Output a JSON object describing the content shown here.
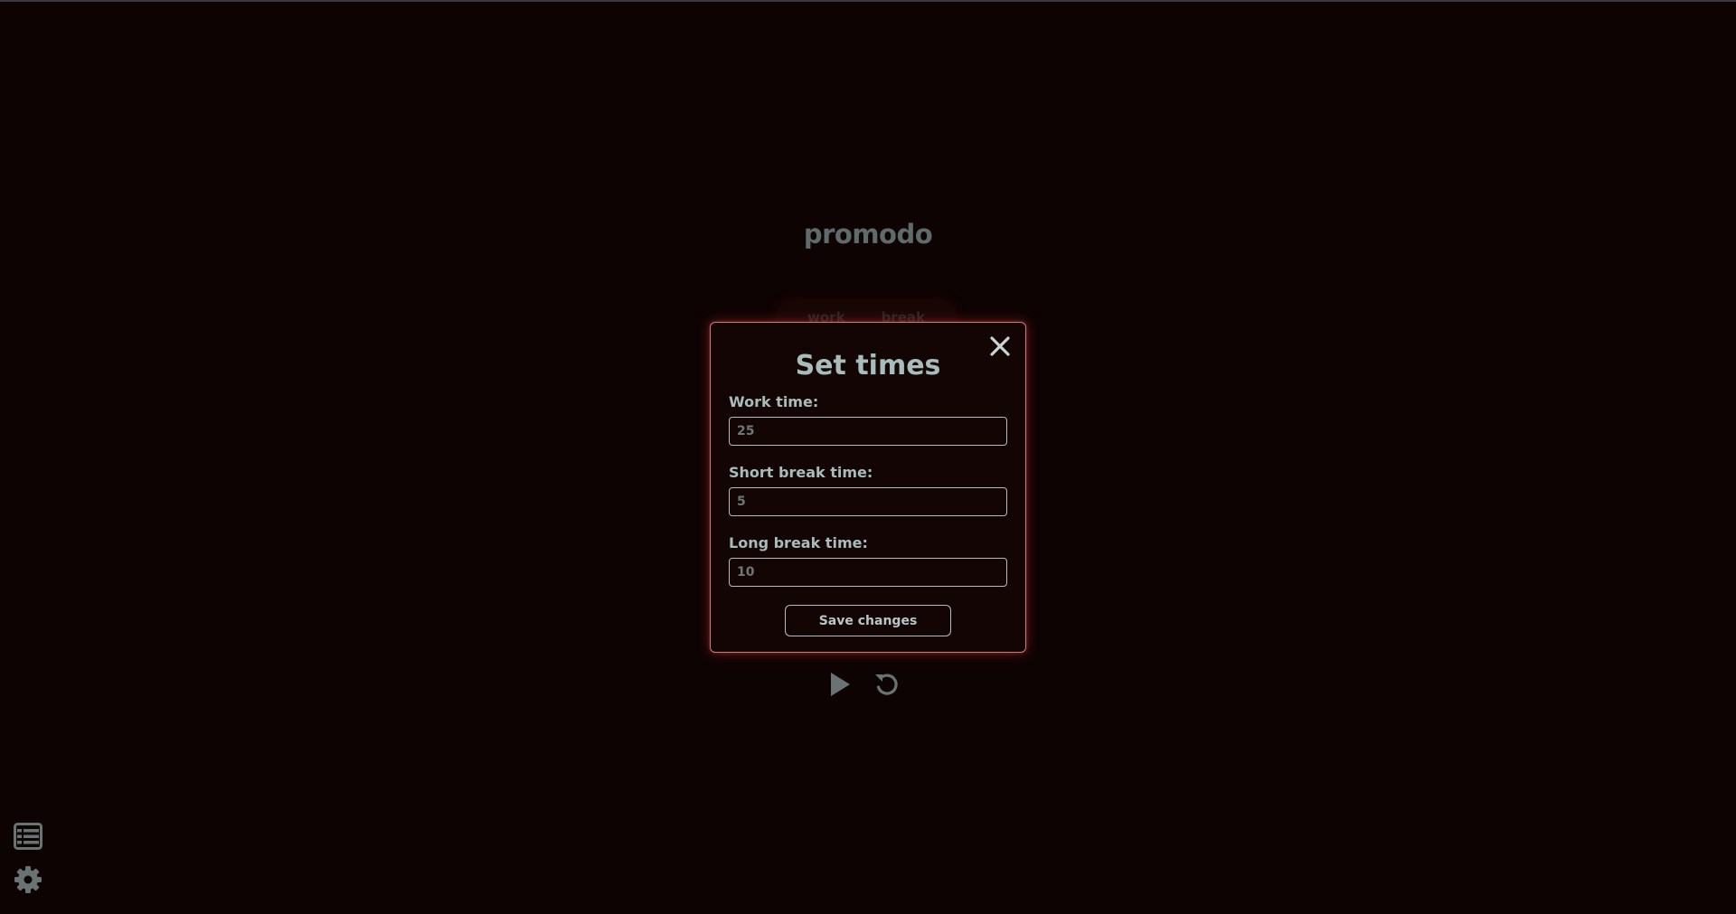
{
  "app": {
    "title": "promodo"
  },
  "mode_tabs": [
    {
      "label": "work"
    },
    {
      "label": "break"
    }
  ],
  "modal": {
    "title": "Set times",
    "fields": [
      {
        "label": "Work time:",
        "placeholder": "25"
      },
      {
        "label": "Short break time:",
        "placeholder": "5"
      },
      {
        "label": "Long break time:",
        "placeholder": "10"
      }
    ],
    "save_label": "Save changes"
  },
  "icons": {
    "close": "close-icon",
    "play": "play-icon",
    "reset": "reset-icon",
    "list": "list-icon",
    "settings": "gear-icon"
  },
  "colors": {
    "background": "#0e0303",
    "text_muted": "#a9bcbc",
    "modal_border": "#c77a7a",
    "glow": "#aa2828"
  }
}
